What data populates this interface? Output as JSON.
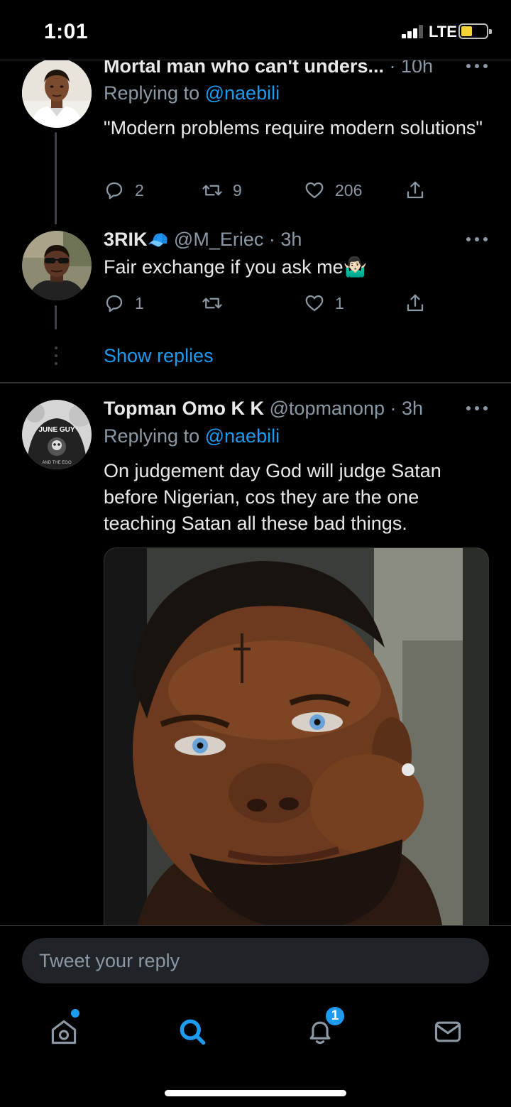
{
  "status_bar": {
    "time": "1:01",
    "network": "LTE",
    "accent_color": "#f6d23a"
  },
  "theme": {
    "background": "#000000",
    "link_color": "#1d9bf0",
    "muted_color": "#8b98a5"
  },
  "tweets": [
    {
      "display_name": "Mortal man who can't unders...",
      "meta": "· 10h",
      "replying_prefix": "Replying to",
      "replying_handle": "@naebili",
      "text": "\"Modern problems require modern solutions\"",
      "reply_count": "2",
      "retweet_count": "9",
      "like_count": "206"
    },
    {
      "display_name": "3RIK",
      "badge_emoji": "🧢",
      "meta": "@M_Eriec · 3h",
      "text": "Fair exchange if you ask me🤷🏻‍♂️",
      "reply_count": "1",
      "retweet_count": "",
      "like_count": "1"
    },
    {
      "display_name": "Topman Omo K K",
      "meta": "@topmanonp · 3h",
      "replying_prefix": "Replying to",
      "replying_handle": "@naebili",
      "text": "On judgement day God will judge Satan before Nigerian, cos they are the one teaching Satan all these bad things."
    }
  ],
  "avatar_shirt_text": [
    "JUNE GUY",
    "AND THE EGO"
  ],
  "show_replies_label": "Show replies",
  "reply_bar": {
    "placeholder": "Tweet your reply"
  },
  "tabbar": {
    "items": [
      {
        "name": "home",
        "icon": "home-icon",
        "has_dot": true
      },
      {
        "name": "search",
        "icon": "search-icon",
        "active": true
      },
      {
        "name": "notifications",
        "icon": "bell-icon",
        "badge": "1"
      },
      {
        "name": "messages",
        "icon": "mail-icon"
      }
    ]
  }
}
